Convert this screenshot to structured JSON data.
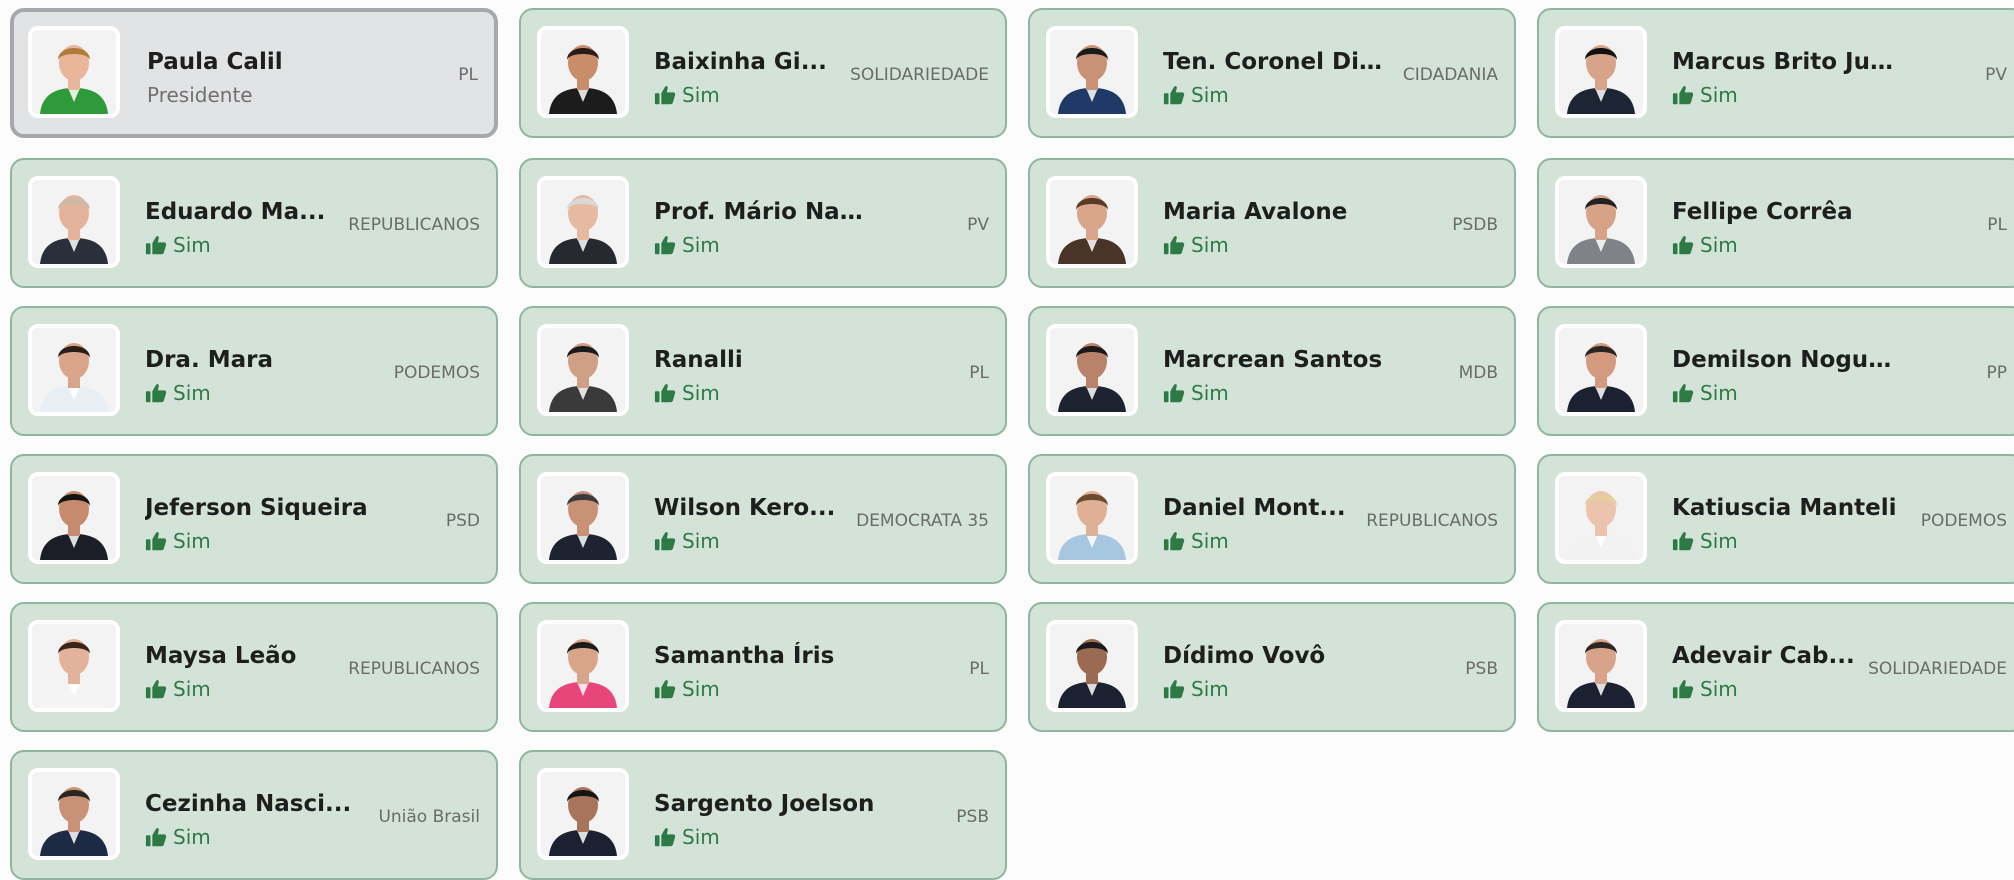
{
  "colors": {
    "card_bg": "#d3e3d8",
    "card_border": "#8fb6a0",
    "president_bg": "#e2e3e5",
    "vote_text": "#2e7a45"
  },
  "icons": {
    "vote": "thumbs-up-icon",
    "photo": "person-photo"
  },
  "members": [
    {
      "name": "Paula Calil",
      "party": "PL",
      "vote": "Presidente",
      "president": true,
      "shirt": "#2f9a3a",
      "hair": "#b07a3a",
      "skin": "#e8b69a"
    },
    {
      "name": "Baixinha Gi...",
      "party": "SOLIDARIEDADE",
      "vote": "Sim",
      "shirt": "#1c1c1c",
      "hair": "#2a1b14",
      "skin": "#c98d6a"
    },
    {
      "name": "Ten. Coronel Dias",
      "party": "CIDADANIA",
      "vote": "Sim",
      "shirt": "#1f3a66",
      "hair": "#1b1b1b",
      "skin": "#c99277"
    },
    {
      "name": "Marcus Brito Junior",
      "party": "PV",
      "vote": "Sim",
      "shirt": "#1d2433",
      "hair": "#111111",
      "skin": "#d7a48a"
    },
    {
      "name": "Eduardo Ma...",
      "party": "REPUBLICANOS",
      "vote": "Sim",
      "shirt": "#2a2f3a",
      "hair": "#ccb9a8",
      "skin": "#e3b49b"
    },
    {
      "name": "Prof. Mário Nadaf",
      "party": "PV",
      "vote": "Sim",
      "shirt": "#262a30",
      "hair": "#d8d8d8",
      "skin": "#e6b9a1"
    },
    {
      "name": "Maria Avalone",
      "party": "PSDB",
      "vote": "Sim",
      "shirt": "#4a3427",
      "hair": "#5a3a26",
      "skin": "#d9a58a"
    },
    {
      "name": "Fellipe Corrêa",
      "party": "PL",
      "vote": "Sim",
      "shirt": "#7f8387",
      "hair": "#222222",
      "skin": "#d6a386"
    },
    {
      "name": "Dra. Mara",
      "party": "PODEMOS",
      "vote": "Sim",
      "shirt": "#e8eef4",
      "hair": "#2b1e17",
      "skin": "#d9a58a"
    },
    {
      "name": "Ranalli",
      "party": "PL",
      "vote": "Sim",
      "shirt": "#3a3a3a",
      "hair": "#1b1b1b",
      "skin": "#cf9f86"
    },
    {
      "name": "Marcrean Santos",
      "party": "MDB",
      "vote": "Sim",
      "shirt": "#1d2330",
      "hair": "#1a1a1a",
      "skin": "#b9826a"
    },
    {
      "name": "Demilson Nogueira",
      "party": "PP",
      "vote": "Sim",
      "shirt": "#1b2130",
      "hair": "#2a2622",
      "skin": "#d49a80"
    },
    {
      "name": "Jeferson Siqueira",
      "party": "PSD",
      "vote": "Sim",
      "shirt": "#1b1e26",
      "hair": "#141414",
      "skin": "#c68b6c"
    },
    {
      "name": "Wilson Kero...",
      "party": "DEMOCRATA 35",
      "vote": "Sim",
      "shirt": "#1d2330",
      "hair": "#3a3a3a",
      "skin": "#c99277"
    },
    {
      "name": "Daniel Mont...",
      "party": "REPUBLICANOS",
      "vote": "Sim",
      "shirt": "#a7c6e0",
      "hair": "#6b4a2e",
      "skin": "#e0b096"
    },
    {
      "name": "Katiuscia Manteli",
      "party": "PODEMOS",
      "vote": "Sim",
      "shirt": "#f2f2f2",
      "hair": "#e4cf9d",
      "skin": "#ecc3ad"
    },
    {
      "name": "Maysa Leão",
      "party": "REPUBLICANOS",
      "vote": "Sim",
      "shirt": "#f4f4f4",
      "hair": "#3a2418",
      "skin": "#e2b29a"
    },
    {
      "name": "Samantha Íris",
      "party": "PL",
      "vote": "Sim",
      "shirt": "#e8457a",
      "hair": "#1b1b1b",
      "skin": "#d9a58a"
    },
    {
      "name": "Dídimo Vovô",
      "party": "PSB",
      "vote": "Sim",
      "shirt": "#1b2130",
      "hair": "#1a1a1a",
      "skin": "#9a6a52"
    },
    {
      "name": "Adevair Cab...",
      "party": "SOLIDARIEDADE",
      "vote": "Sim",
      "shirt": "#1b2130",
      "hair": "#2a2622",
      "skin": "#d7a48a"
    },
    {
      "name": "Cezinha Nasci...",
      "party": "União Brasil",
      "vote": "Sim",
      "shirt": "#1d2a44",
      "hair": "#2a2622",
      "skin": "#c99277"
    },
    {
      "name": "Sargento Joelson",
      "party": "PSB",
      "vote": "Sim",
      "shirt": "#1b2130",
      "hair": "#151515",
      "skin": "#a8745b"
    }
  ]
}
